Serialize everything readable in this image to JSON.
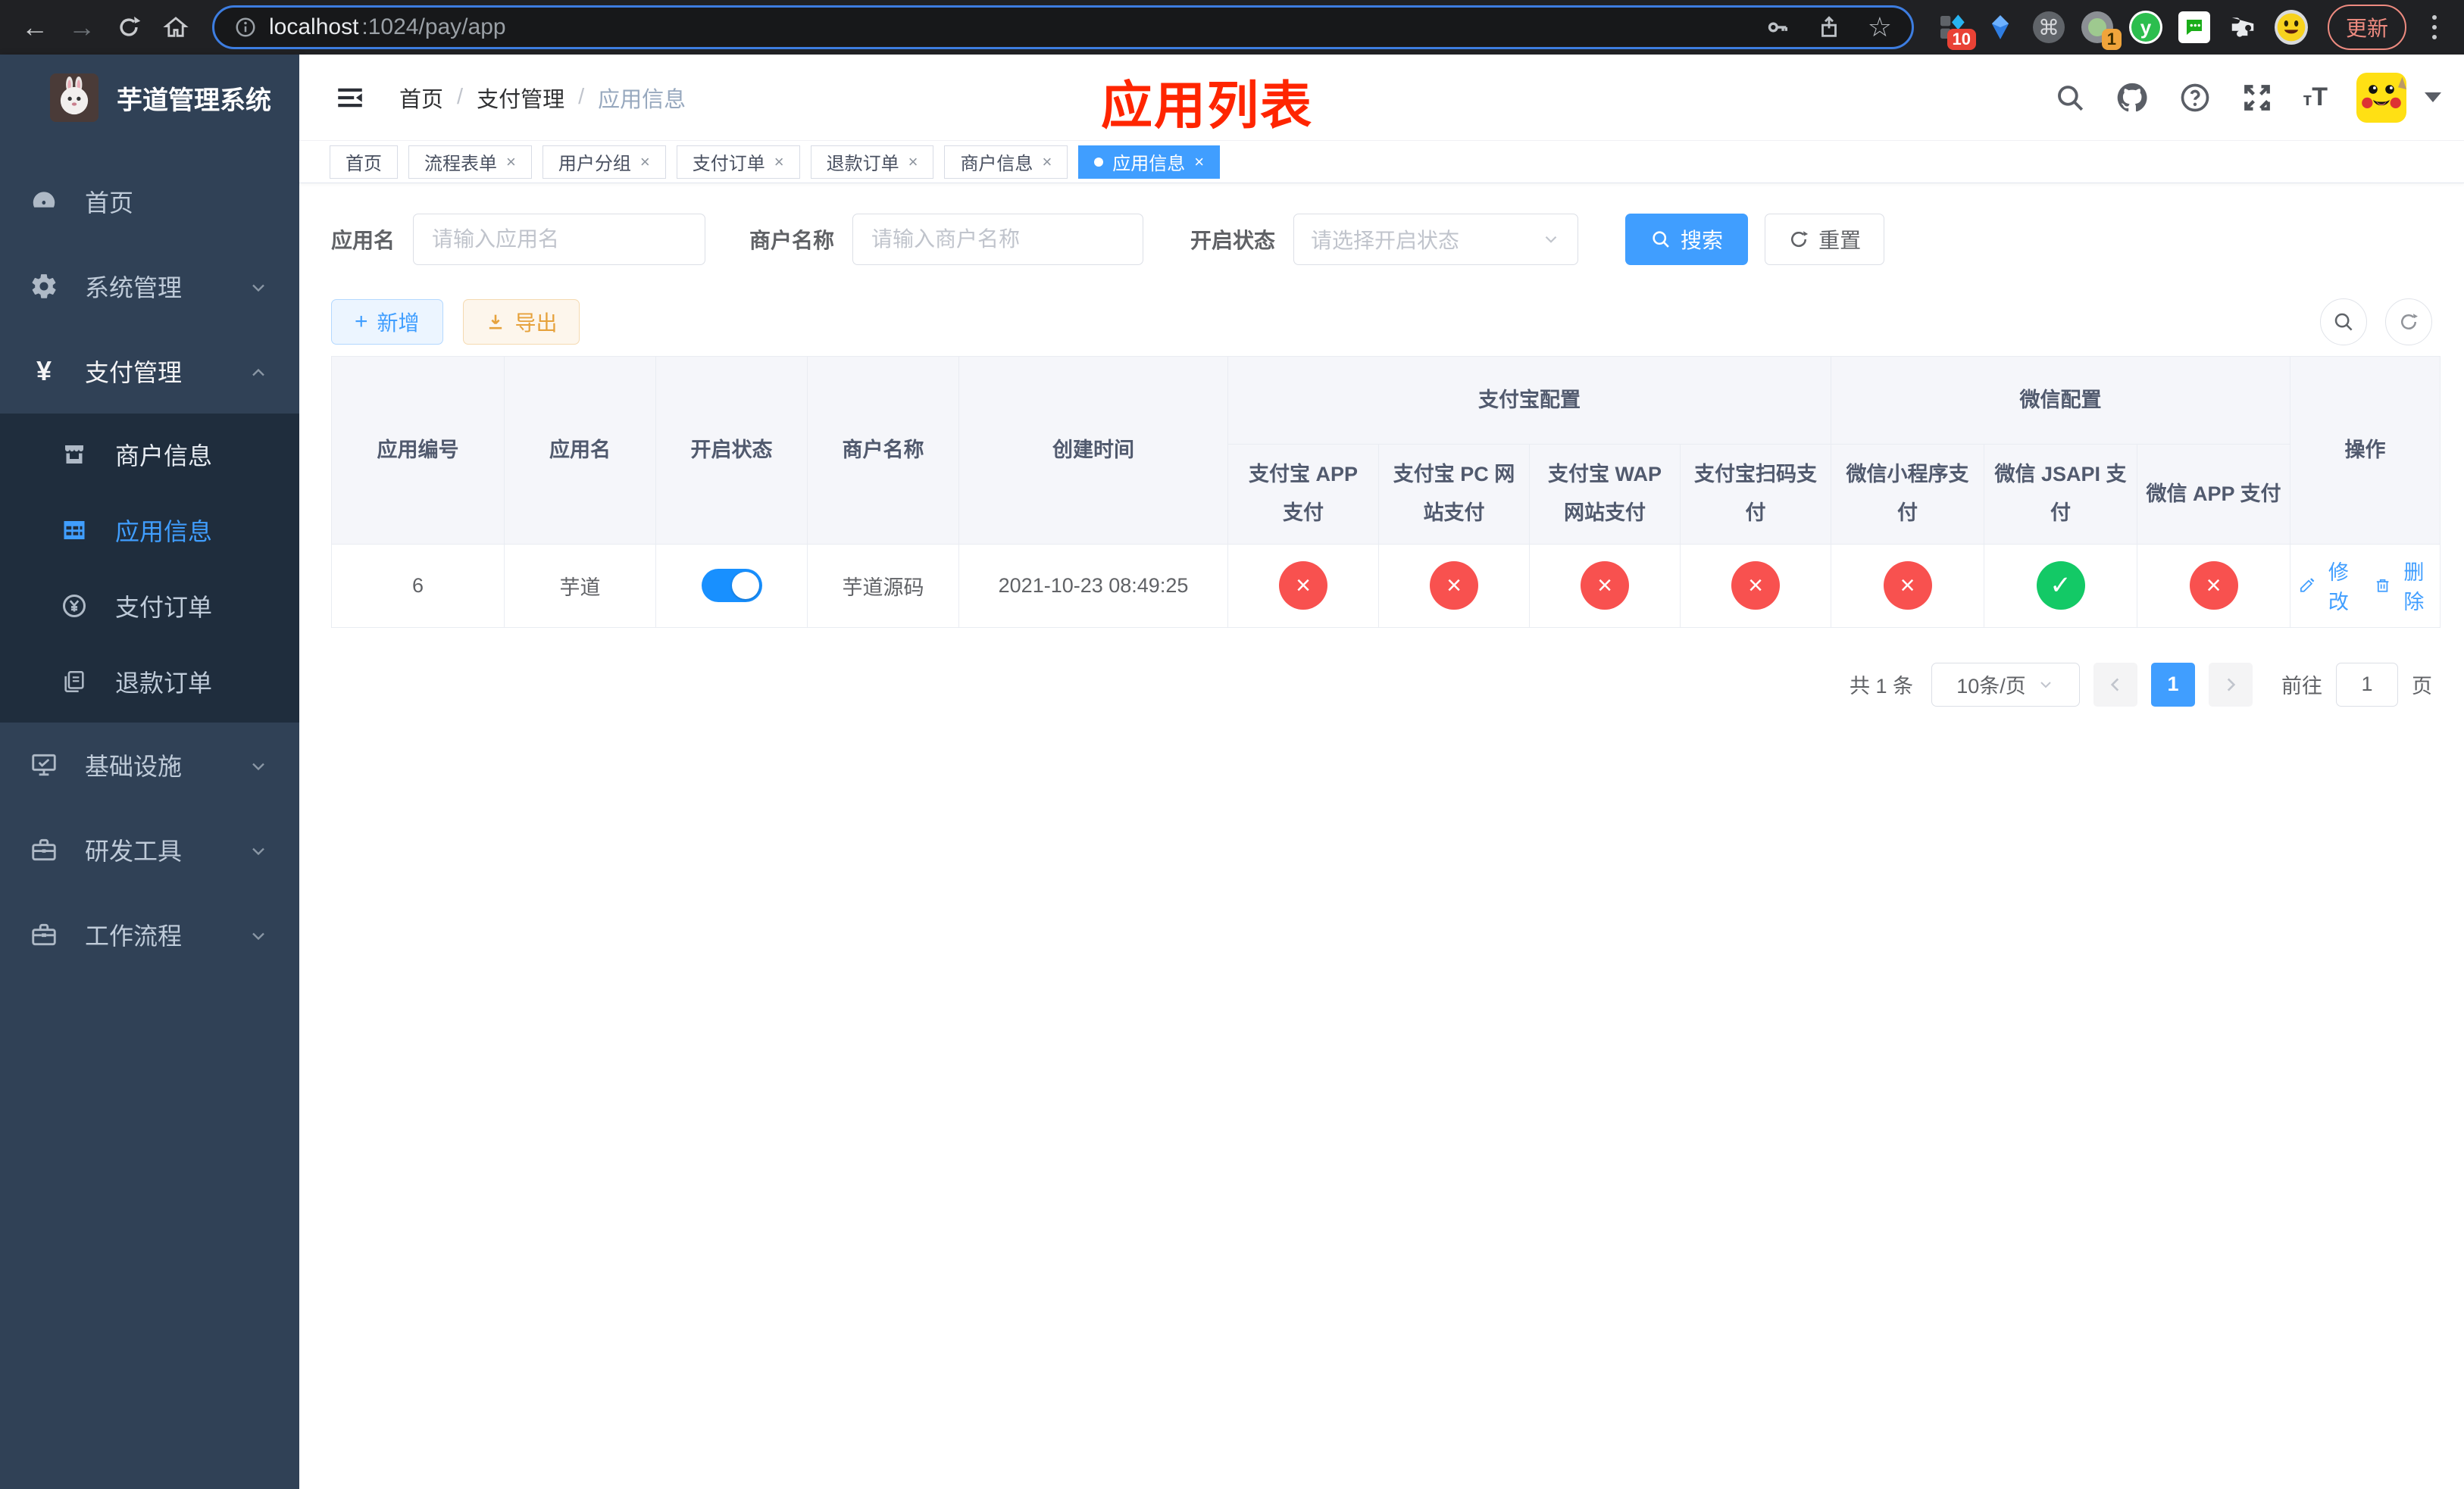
{
  "browser": {
    "url": {
      "host": "localhost",
      "path": ":1024/pay/app"
    },
    "update_label": "更新",
    "extension_badges": {
      "grid_badge": "10",
      "circle_badge": "1"
    },
    "ext_y_label": "y"
  },
  "sidebar": {
    "app_title": "芋道管理系统",
    "items": [
      {
        "label": "首页"
      },
      {
        "label": "系统管理"
      },
      {
        "label": "支付管理"
      },
      {
        "label": "基础设施"
      },
      {
        "label": "研发工具"
      },
      {
        "label": "工作流程"
      }
    ],
    "submenu": [
      {
        "label": "商户信息"
      },
      {
        "label": "应用信息"
      },
      {
        "label": "支付订单"
      },
      {
        "label": "退款订单"
      }
    ]
  },
  "header": {
    "breadcrumb": [
      "首页",
      "支付管理",
      "应用信息"
    ],
    "overlay_title": "应用列表"
  },
  "tabs": [
    {
      "label": "首页"
    },
    {
      "label": "流程表单"
    },
    {
      "label": "用户分组"
    },
    {
      "label": "支付订单"
    },
    {
      "label": "退款订单"
    },
    {
      "label": "商户信息"
    },
    {
      "label": "应用信息"
    }
  ],
  "filters": {
    "app_name_label": "应用名",
    "app_name_placeholder": "请输入应用名",
    "merchant_label": "商户名称",
    "merchant_placeholder": "请输入商户名称",
    "status_label": "开启状态",
    "status_placeholder": "请选择开启状态",
    "search_label": "搜索",
    "reset_label": "重置"
  },
  "toolbar": {
    "add_label": "新增",
    "export_label": "导出"
  },
  "table": {
    "group_headers": {
      "alipay": "支付宝配置",
      "wechat": "微信配置"
    },
    "columns": {
      "app_id": "应用编号",
      "app_name": "应用名",
      "enabled": "开启状态",
      "merchant": "商户名称",
      "created": "创建时间",
      "alipay_app": "支付宝 APP 支付",
      "alipay_pc": "支付宝 PC 网站支付",
      "alipay_wap": "支付宝 WAP 网站支付",
      "alipay_qr": "支付宝扫码支付",
      "wx_mini": "微信小程序支付",
      "wx_jsapi": "微信 JSAPI 支付",
      "wx_app": "微信 APP 支付",
      "actions": "操作"
    },
    "row": {
      "app_id": "6",
      "app_name": "芋道",
      "enabled": true,
      "merchant": "芋道源码",
      "created": "2021-10-23 08:49:25",
      "payment_configs": [
        false,
        false,
        false,
        false,
        false,
        true,
        false
      ],
      "edit_label": "修改",
      "delete_label": "删除"
    }
  },
  "pagination": {
    "total": "共 1 条",
    "page_size": "10条/页",
    "page": "1",
    "goto_label": "前往",
    "goto_value": "1",
    "unit_label": "页"
  },
  "colors": {
    "accent": "#409eff",
    "success": "#13c966",
    "danger": "#f8514f",
    "warning": "#e6a23c",
    "title_red": "#ff2500",
    "sidebar_bg": "#304156",
    "submenu_bg": "#1f2d3d"
  }
}
